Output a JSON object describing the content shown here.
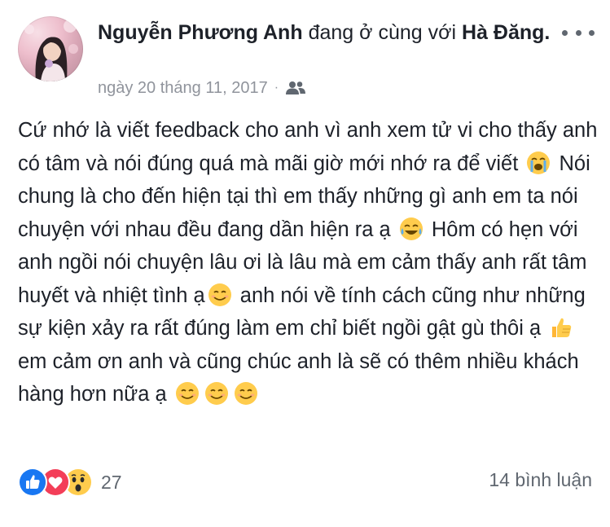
{
  "post": {
    "author": "Nguyễn Phương Anh",
    "with_text": "đang ở cùng với",
    "tagged": "Hà Đăng.",
    "date": "ngày 20 tháng 11, 2017",
    "separator": "·",
    "privacy_icon": "friends-icon",
    "more_icon": "more-horizontal-icon",
    "body": [
      "Cứ nhớ là viết feedback cho anh vì anh xem tử vi cho thấy anh có tâm và nói đúng quá mà mãi giờ mới nhớ ra để viết",
      "Nói chung là cho đến hiện tại thì em thấy những gì anh em ta nói chuyện với nhau đều đang dần hiện ra ạ",
      "Hôm có hẹn với anh ngồi nói chuyện lâu ơi là lâu mà em cảm thấy anh rất tâm huyết và nhiệt tình ạ",
      "anh nói về tính cách cũng như những sự kiện xảy ra rất đúng làm em chỉ biết ngồi gật gù thôi ạ",
      "em cảm ơn anh và cũng chúc anh là sẽ có thêm nhiều khách hàng hơn nữa ạ"
    ],
    "emojis": [
      "loudly-crying-emoji",
      "tears-of-joy-emoji",
      "smiling-emoji",
      "thumbs-up-emoji",
      "smiling-emoji",
      "smiling-emoji",
      "smiling-emoji"
    ]
  },
  "footer": {
    "reactions": [
      "like-icon",
      "love-icon",
      "wow-icon"
    ],
    "reaction_count": "27",
    "comments": "14 bình luận"
  },
  "colors": {
    "text": "#1d2129",
    "meta": "#90949c",
    "like": "#1877f2",
    "love": "#f33e58",
    "emoji": "#ffcc4d"
  }
}
